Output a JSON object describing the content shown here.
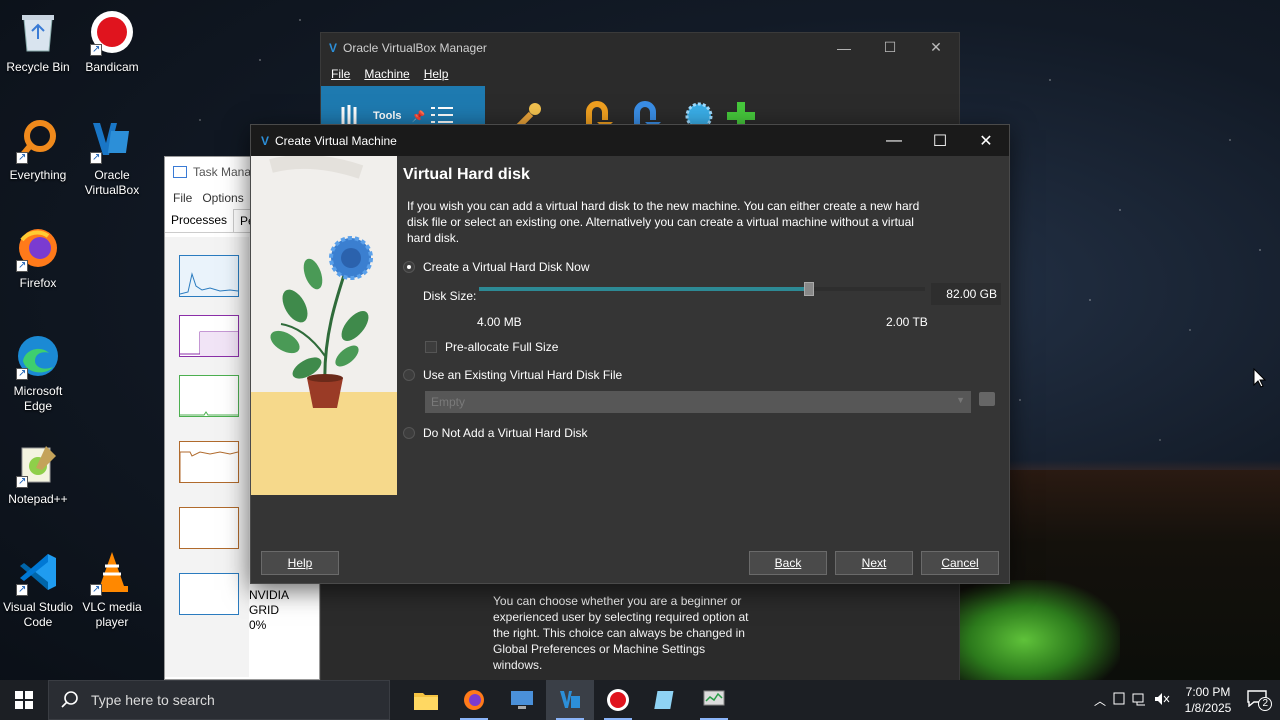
{
  "desktop": {
    "icons": [
      {
        "label": "Recycle Bin"
      },
      {
        "label": "Bandicam"
      },
      {
        "label": "Everything"
      },
      {
        "label": "Oracle VirtualBox"
      },
      {
        "label": "Firefox"
      },
      {
        "label": "Microsoft Edge"
      },
      {
        "label": "Notepad++"
      },
      {
        "label": "Visual Studio Code"
      },
      {
        "label": "VLC media player"
      }
    ]
  },
  "vbox_manager": {
    "title": "Oracle VirtualBox Manager",
    "menu": [
      "File",
      "Machine",
      "Help"
    ],
    "tools_label": "Tools",
    "description": "You can choose whether you are a beginner or experienced user by selecting required option at the right. This choice can always be changed in Global Preferences or Machine Settings windows."
  },
  "task_manager": {
    "title": "Task Manag",
    "menu": [
      "File",
      "Options"
    ],
    "tabs": [
      "Processes",
      "Per"
    ],
    "gpu_label": "NVIDIA GRID",
    "gpu_value": "0%"
  },
  "dialog": {
    "title": "Create Virtual Machine",
    "heading": "Virtual Hard disk",
    "intro": "If you wish you can add a virtual hard disk to the new machine. You can either create a new hard disk file or select an existing one. Alternatively you can create a virtual machine without a virtual hard disk.",
    "options": {
      "create_now": "Create a Virtual Hard Disk Now",
      "use_existing": "Use an Existing Virtual Hard Disk File",
      "do_not_add": "Do Not Add a Virtual Hard Disk"
    },
    "selected_option": "create_now",
    "disk_size_label": "Disk Size:",
    "disk_size_value": "82.00 GB",
    "slider_position": 0.74,
    "range_min": "4.00 MB",
    "range_max": "2.00 TB",
    "preallocate_label": "Pre-allocate Full Size",
    "existing_file_value": "Empty",
    "buttons": {
      "help": "Help",
      "back": "Back",
      "next": "Next",
      "cancel": "Cancel"
    }
  },
  "taskbar": {
    "search_placeholder": "Type here to search",
    "time": "7:00 PM",
    "date": "1/8/2025",
    "notification_count": "2"
  },
  "colors": {
    "slider_fill": "#2d8a95",
    "vbox_tools_accent": "#1e7ab0",
    "bandicam_red": "#e0141e"
  }
}
